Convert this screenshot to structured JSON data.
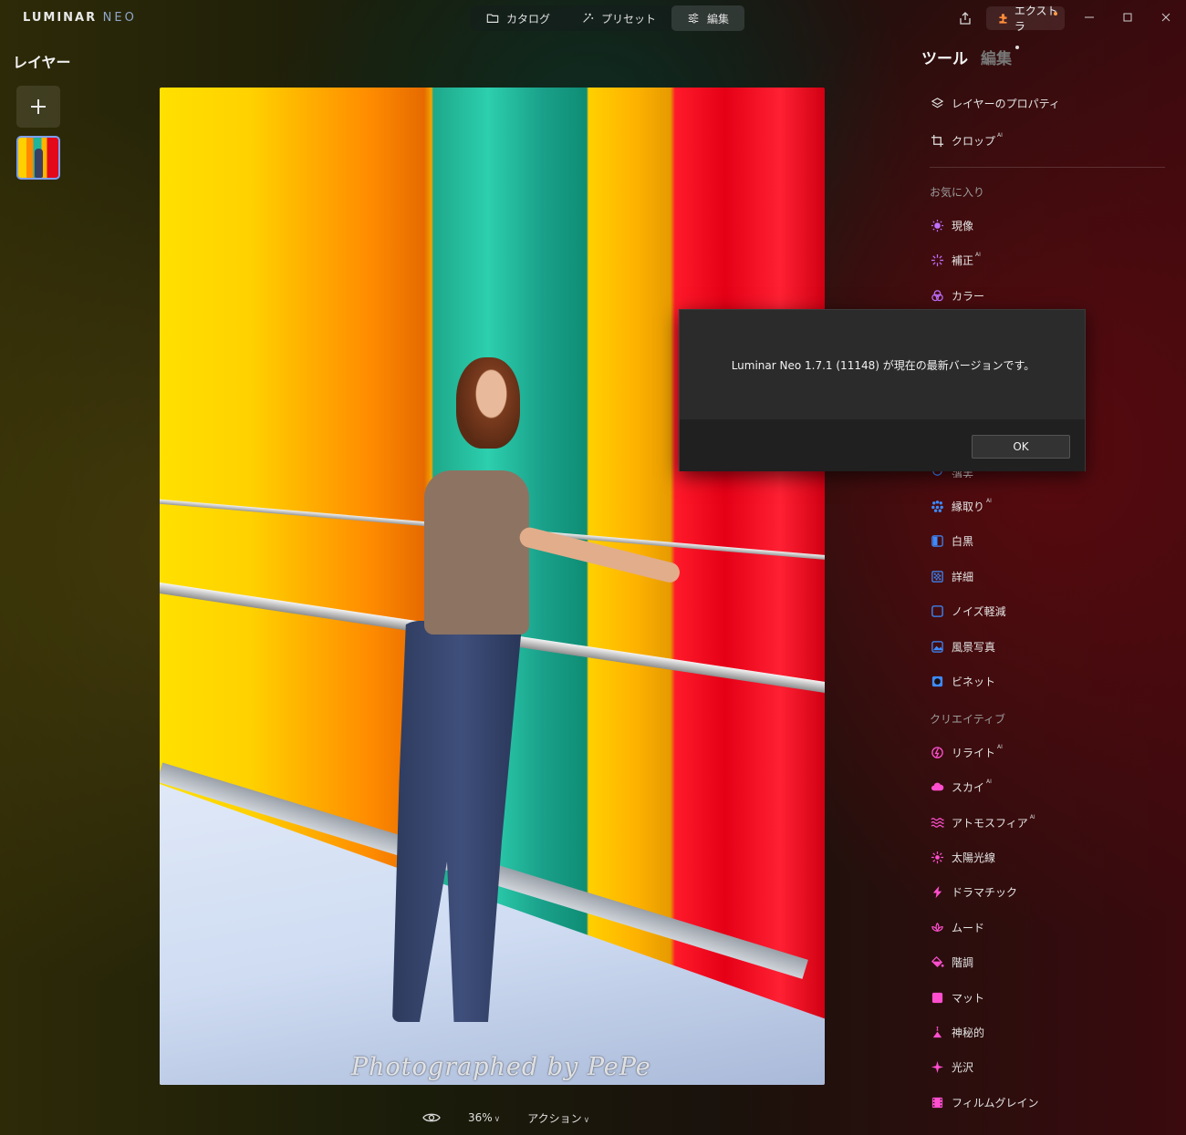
{
  "app": {
    "logo_main": "LUMINAR",
    "logo_sub": "NEO"
  },
  "modes": [
    {
      "label": "カタログ",
      "icon": "folder-icon"
    },
    {
      "label": "プリセット",
      "icon": "sparkle-icon"
    },
    {
      "label": "編集",
      "icon": "sliders-icon",
      "active": true
    }
  ],
  "header": {
    "extra_label": "エクストラ"
  },
  "layers": {
    "title": "レイヤー"
  },
  "photo": {
    "watermark": "Photographed by PePe"
  },
  "bottom_bar": {
    "zoom": "36%",
    "actions": "アクション"
  },
  "panel": {
    "tabs": {
      "tools": "ツール",
      "edits": "編集"
    },
    "top_tools": [
      {
        "label": "レイヤーのプロパティ",
        "icon": "layers-icon"
      },
      {
        "label": "クロップ",
        "ai": "AI",
        "icon": "crop-icon"
      }
    ],
    "section_favorites": "お気に入り",
    "favorites": [
      {
        "label": "現像",
        "icon": "sun-icon",
        "color": "#c070ff"
      },
      {
        "label": "補正",
        "ai": "AI",
        "icon": "enhance-icon",
        "color": "#c070ff"
      },
      {
        "label": "カラー",
        "icon": "color-icon",
        "color": "#c070ff"
      }
    ],
    "partial_item": "消去",
    "favorites_2": [
      {
        "label": "縁取り",
        "ai": "AI",
        "icon": "dots-icon",
        "color": "#3d8bff"
      },
      {
        "label": "白黒",
        "icon": "bw-icon",
        "color": "#3d8bff"
      },
      {
        "label": "詳細",
        "icon": "detail-icon",
        "color": "#3d8bff"
      },
      {
        "label": "ノイズ軽減",
        "icon": "noise-icon",
        "color": "#3d8bff"
      },
      {
        "label": "風景写真",
        "icon": "landscape-icon",
        "color": "#3d8bff"
      },
      {
        "label": "ビネット",
        "icon": "vignette-icon",
        "color": "#3d8bff"
      }
    ],
    "section_creative": "クリエイティブ",
    "creative": [
      {
        "label": "リライト",
        "ai": "AI",
        "icon": "relight-icon",
        "color": "#ff4fcf"
      },
      {
        "label": "スカイ",
        "ai": "AI",
        "icon": "cloud-icon",
        "color": "#ff4fcf"
      },
      {
        "label": "アトモスフィア",
        "ai": "AI",
        "icon": "waves-icon",
        "color": "#ff4fcf"
      },
      {
        "label": "太陽光線",
        "icon": "sunrays-icon",
        "color": "#ff4fcf"
      },
      {
        "label": "ドラマチック",
        "icon": "bolt-icon",
        "color": "#ff4fcf"
      },
      {
        "label": "ムード",
        "icon": "lotus-icon",
        "color": "#ff4fcf"
      },
      {
        "label": "階調",
        "icon": "bucket-icon",
        "color": "#ff4fcf"
      },
      {
        "label": "マット",
        "icon": "square-icon",
        "color": "#ff4fcf"
      },
      {
        "label": "神秘的",
        "icon": "mystic-icon",
        "color": "#ff4fcf"
      },
      {
        "label": "光沢",
        "icon": "glow-icon",
        "color": "#ff4fcf"
      },
      {
        "label": "フィルムグレイン",
        "icon": "film-icon",
        "color": "#ff4fcf"
      }
    ]
  },
  "dialog": {
    "message": "Luminar Neo 1.7.1 (11148) が現在の最新バージョンです。",
    "ok": "OK"
  }
}
